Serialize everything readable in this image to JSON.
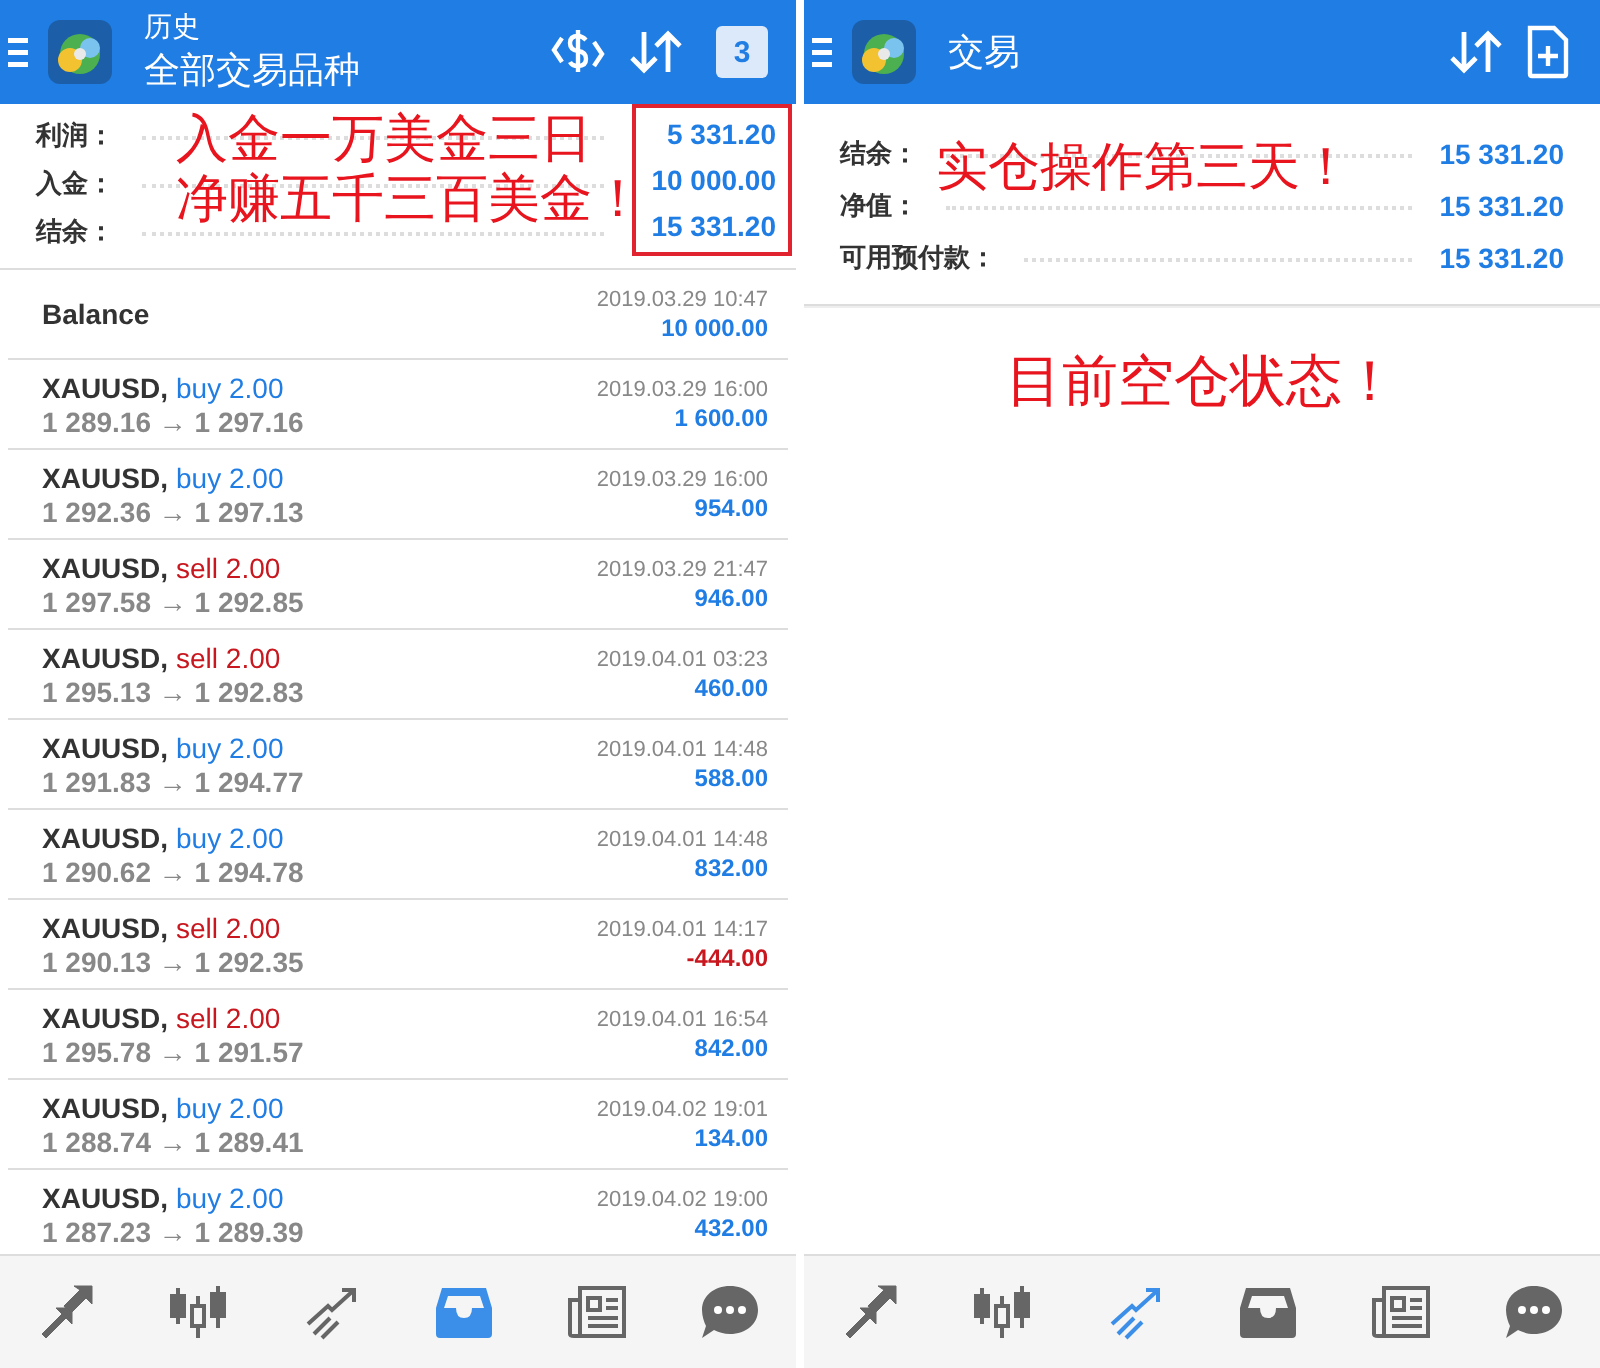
{
  "left_panel": {
    "header": {
      "title": "历史",
      "subtitle": "全部交易品种",
      "calendar_badge": "3"
    },
    "summary": [
      {
        "label": "利润：",
        "value": "5 331.20"
      },
      {
        "label": "入金：",
        "value": "10 000.00"
      },
      {
        "label": "结余：",
        "value": "15 331.20"
      }
    ],
    "annotation": [
      "入金一万美金三日",
      "净赚五千三百美金！"
    ],
    "deals": [
      {
        "kind": "balance",
        "symbol": "Balance",
        "time": "2019.03.29 10:47",
        "profit": "10 000.00",
        "loss": false
      },
      {
        "kind": "trade",
        "symbol": "XAUUSD,",
        "side": "buy 2.00",
        "sell": false,
        "prices": "1 289.16 → 1 297.16",
        "time": "2019.03.29 16:00",
        "profit": "1 600.00",
        "loss": false
      },
      {
        "kind": "trade",
        "symbol": "XAUUSD,",
        "side": "buy 2.00",
        "sell": false,
        "prices": "1 292.36 → 1 297.13",
        "time": "2019.03.29 16:00",
        "profit": "954.00",
        "loss": false
      },
      {
        "kind": "trade",
        "symbol": "XAUUSD,",
        "side": "sell 2.00",
        "sell": true,
        "prices": "1 297.58 → 1 292.85",
        "time": "2019.03.29 21:47",
        "profit": "946.00",
        "loss": false
      },
      {
        "kind": "trade",
        "symbol": "XAUUSD,",
        "side": "sell 2.00",
        "sell": true,
        "prices": "1 295.13 → 1 292.83",
        "time": "2019.04.01 03:23",
        "profit": "460.00",
        "loss": false
      },
      {
        "kind": "trade",
        "symbol": "XAUUSD,",
        "side": "buy 2.00",
        "sell": false,
        "prices": "1 291.83 → 1 294.77",
        "time": "2019.04.01 14:48",
        "profit": "588.00",
        "loss": false
      },
      {
        "kind": "trade",
        "symbol": "XAUUSD,",
        "side": "buy 2.00",
        "sell": false,
        "prices": "1 290.62 → 1 294.78",
        "time": "2019.04.01 14:48",
        "profit": "832.00",
        "loss": false
      },
      {
        "kind": "trade",
        "symbol": "XAUUSD,",
        "side": "sell 2.00",
        "sell": true,
        "prices": "1 290.13 → 1 292.35",
        "time": "2019.04.01 14:17",
        "profit": "-444.00",
        "loss": true
      },
      {
        "kind": "trade",
        "symbol": "XAUUSD,",
        "side": "sell 2.00",
        "sell": true,
        "prices": "1 295.78 → 1 291.57",
        "time": "2019.04.01 16:54",
        "profit": "842.00",
        "loss": false
      },
      {
        "kind": "trade",
        "symbol": "XAUUSD,",
        "side": "buy 2.00",
        "sell": false,
        "prices": "1 288.74 → 1 289.41",
        "time": "2019.04.02 19:01",
        "profit": "134.00",
        "loss": false
      },
      {
        "kind": "trade",
        "symbol": "XAUUSD,",
        "side": "buy 2.00",
        "sell": false,
        "prices": "1 287.23 → 1 289.39",
        "time": "2019.04.02 19:00",
        "profit": "432.00",
        "loss": false
      }
    ],
    "nav": [
      {
        "kind": "quotes",
        "selected": false
      },
      {
        "kind": "chart",
        "selected": false
      },
      {
        "kind": "trade",
        "selected": false
      },
      {
        "kind": "history",
        "selected": true
      },
      {
        "kind": "news",
        "selected": false
      },
      {
        "kind": "chat",
        "selected": false
      }
    ]
  },
  "right_panel": {
    "header": {
      "title": "交易"
    },
    "summary": [
      {
        "label": "结余：",
        "value": "15 331.20"
      },
      {
        "label": "净值：",
        "value": "15 331.20"
      },
      {
        "label": "可用预付款：",
        "value": "15 331.20"
      }
    ],
    "annotation": "实仓操作第三天！",
    "status_note": "目前空仓状态！",
    "nav": [
      {
        "kind": "quotes",
        "selected": false
      },
      {
        "kind": "chart",
        "selected": false
      },
      {
        "kind": "trade",
        "selected": true
      },
      {
        "kind": "history",
        "selected": false
      },
      {
        "kind": "news",
        "selected": false
      },
      {
        "kind": "chat",
        "selected": false
      }
    ]
  }
}
